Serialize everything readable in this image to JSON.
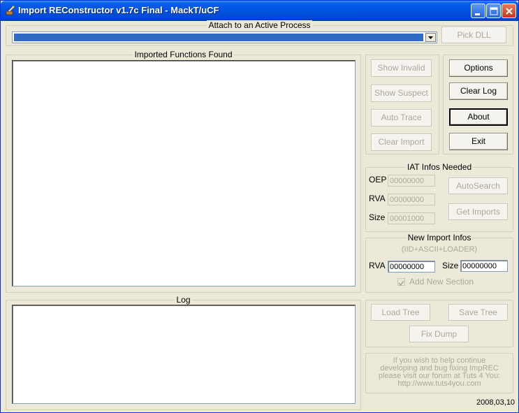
{
  "window": {
    "title": "Import REConstructor v1.7c Final - MackT/uCF"
  },
  "attach": {
    "legend": "Attach to an Active Process",
    "pick_dll": "Pick DLL"
  },
  "imported": {
    "legend": "Imported Functions Found"
  },
  "actions": {
    "show_invalid": "Show Invalid",
    "show_suspect": "Show Suspect",
    "auto_trace": "Auto Trace",
    "clear_import": "Clear Import"
  },
  "right_buttons": {
    "options": "Options",
    "clear_log": "Clear Log",
    "about": "About",
    "exit": "Exit"
  },
  "iat": {
    "legend": "IAT Infos Needed",
    "oep_label": "OEP",
    "oep_value": "00000000",
    "rva_label": "RVA",
    "rva_value": "00000000",
    "size_label": "Size",
    "size_value": "00001000",
    "autosearch": "AutoSearch",
    "get_imports": "Get Imports"
  },
  "new_import": {
    "legend": "New Import Infos",
    "subtitle": "(IID+ASCII+LOADER)",
    "rva_label": "RVA",
    "rva_value": "00000000",
    "size_label": "Size",
    "size_value": "00000000",
    "add_section": "Add New Section"
  },
  "log": {
    "legend": "Log"
  },
  "tree": {
    "load": "Load Tree",
    "save": "Save Tree",
    "fix_dump": "Fix Dump"
  },
  "info": {
    "line1": "If you wish to help continue",
    "line2": "developing and bug fixing ImpREC",
    "line3": "please visit our forum at Tuts 4 You:",
    "line4": "http://www.tuts4you.com"
  },
  "version": "2008,03,10"
}
